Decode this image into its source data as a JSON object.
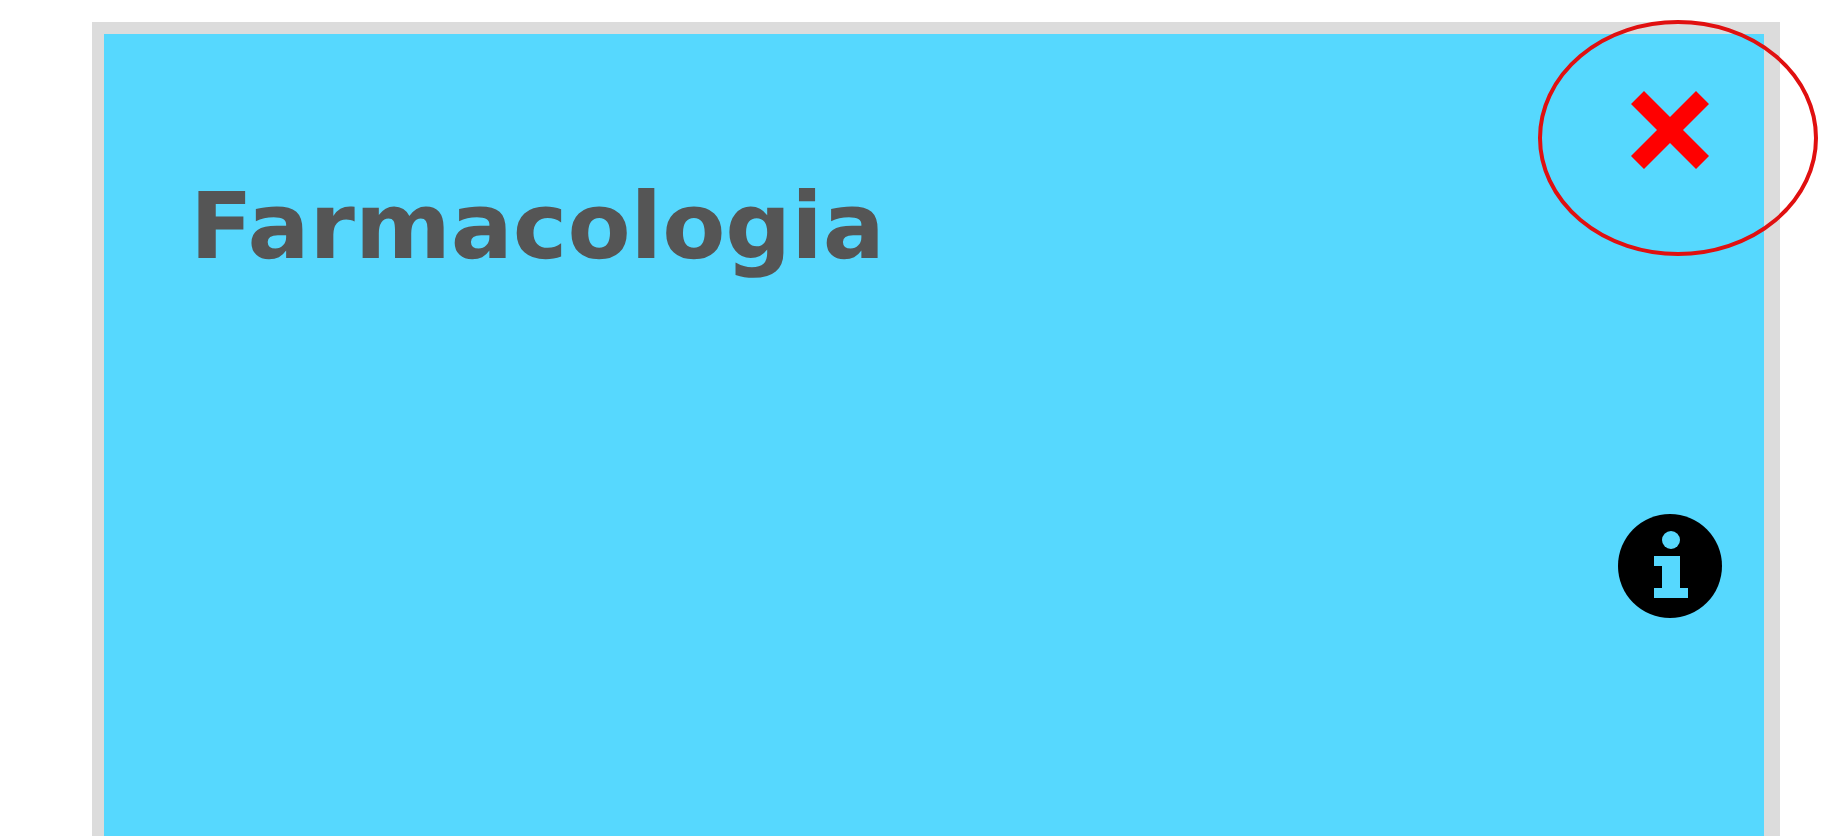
{
  "card": {
    "title": "Farmacologia"
  },
  "annotation": {
    "kind": "ellipse"
  }
}
